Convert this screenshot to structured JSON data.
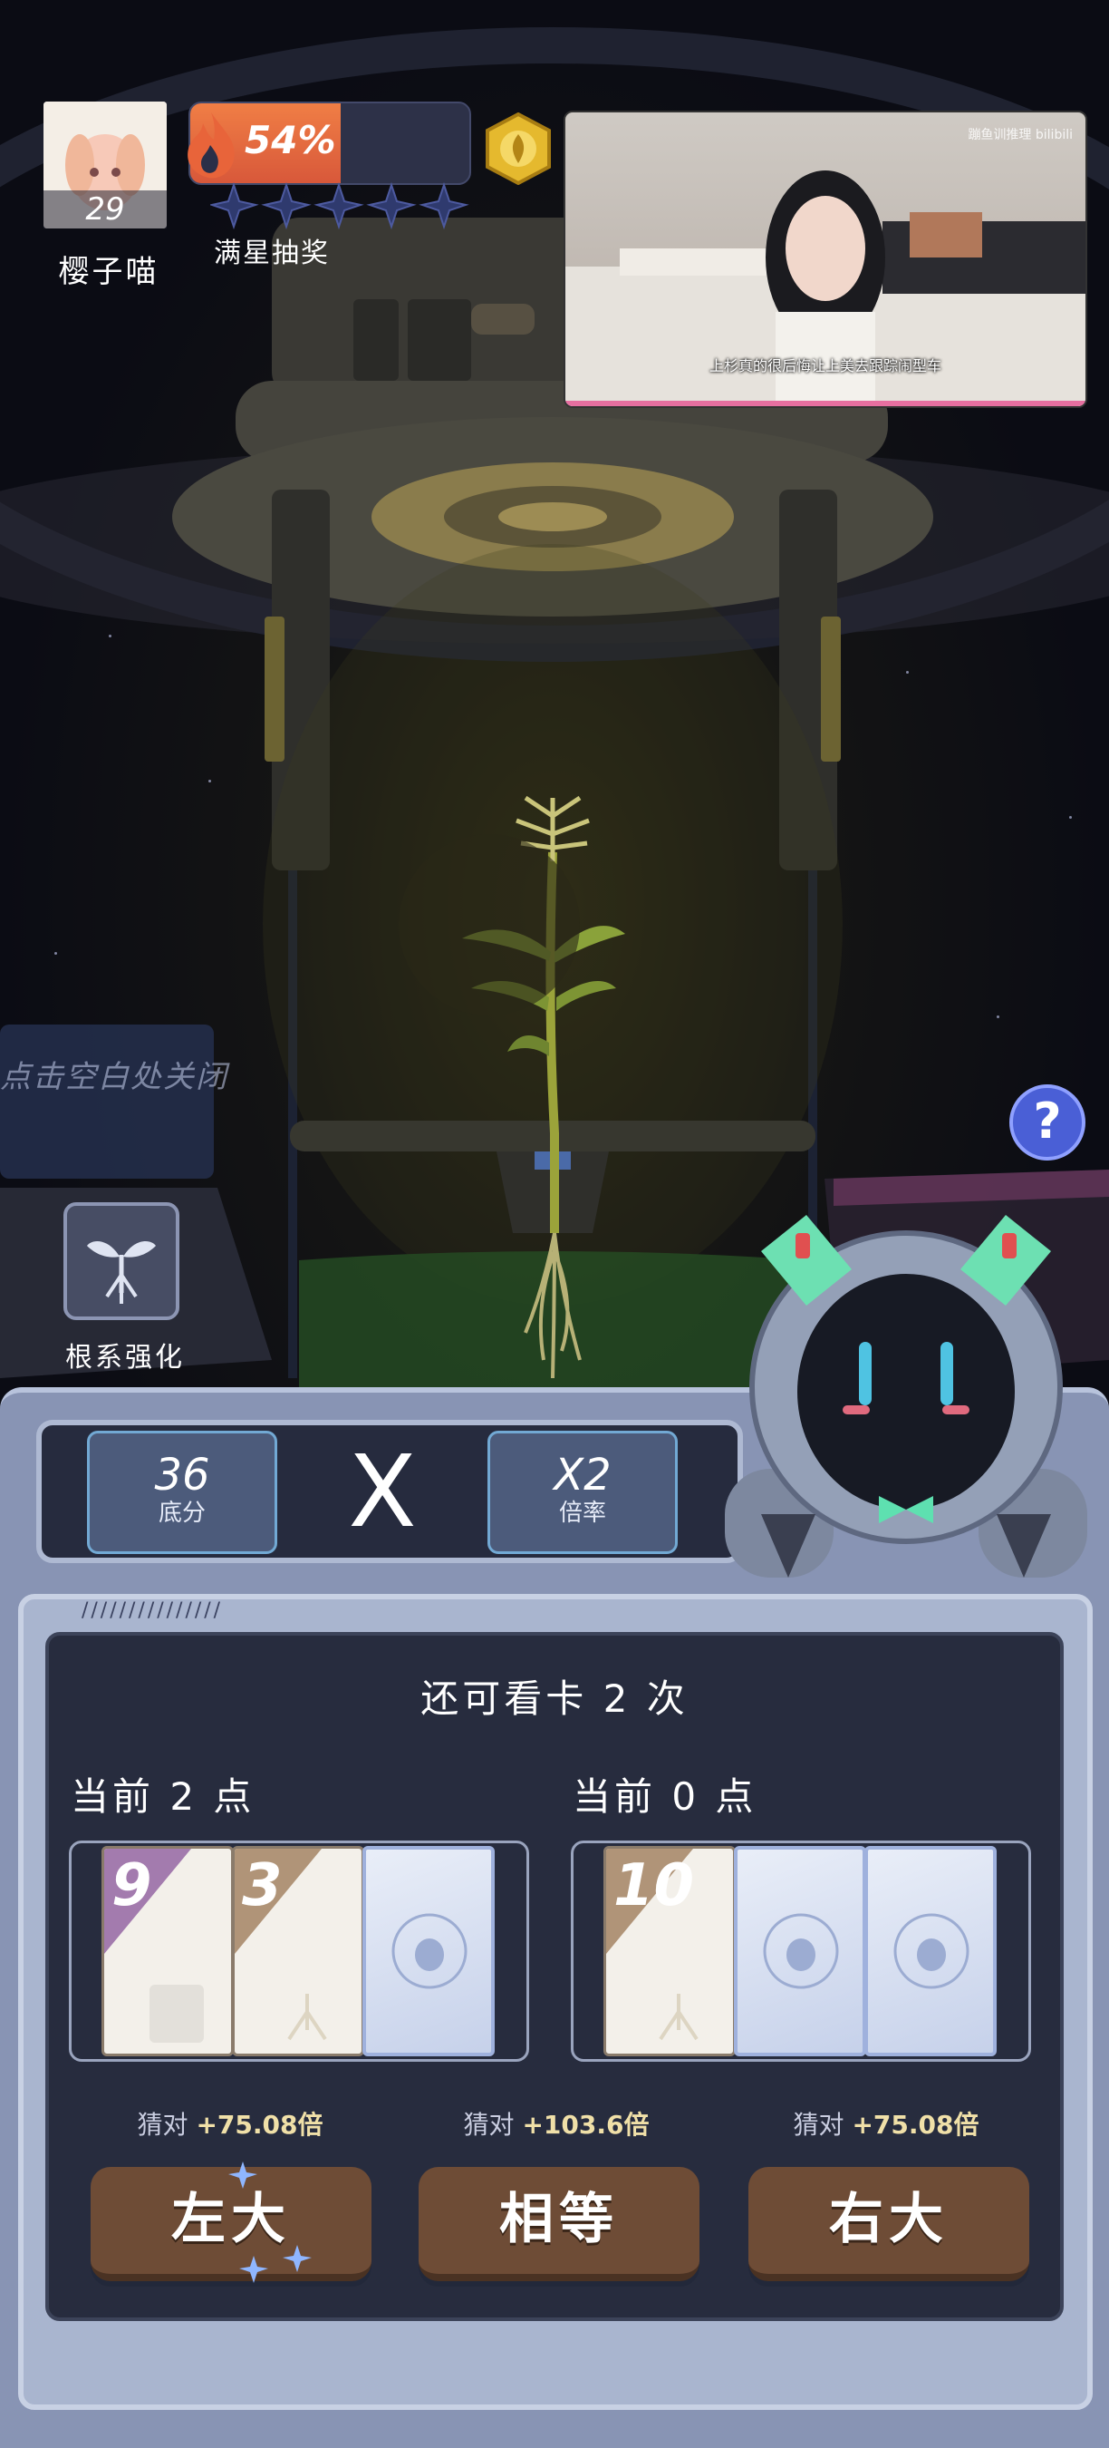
{
  "player": {
    "level": "29",
    "name": "樱子喵"
  },
  "progress": {
    "value_text": "54%",
    "value": 0.54
  },
  "star_lottery": {
    "label": "满星抽奖",
    "filled_stars": 0,
    "total_stars": 5
  },
  "video": {
    "watermark": "蹦鱼训推理 bilibili",
    "subtitle": "上杉真的很后悔让上美去跟踪闹型车"
  },
  "scene": {
    "close_hint": "点击空白处关闭",
    "root_boost_label": "根系强化",
    "help_label": "?"
  },
  "score": {
    "base_value": "36",
    "base_label": "底分",
    "times_sign": "X",
    "multiplier_value": "X2",
    "multiplier_label": "倍率"
  },
  "round": {
    "views_left": "还可看卡 2 次"
  },
  "left_hand": {
    "label": "当前 2 点",
    "cards": [
      {
        "value": "9",
        "color": "#a37bae"
      },
      {
        "value": "3",
        "color": "#b09478"
      },
      {
        "value": "",
        "back": true
      }
    ]
  },
  "right_hand": {
    "label": "当前 0 点",
    "cards": [
      {
        "value": "10",
        "color": "#b09478"
      },
      {
        "value": "",
        "back": true
      },
      {
        "value": "",
        "back": true
      }
    ]
  },
  "bonuses": {
    "left_prefix": "猜对",
    "left_value": "+75.08倍",
    "equal_prefix": "猜对",
    "equal_value": "+103.6倍",
    "right_prefix": "猜对",
    "right_value": "+75.08倍"
  },
  "buttons": {
    "left": "左大",
    "equal": "相等",
    "right": "右大"
  }
}
